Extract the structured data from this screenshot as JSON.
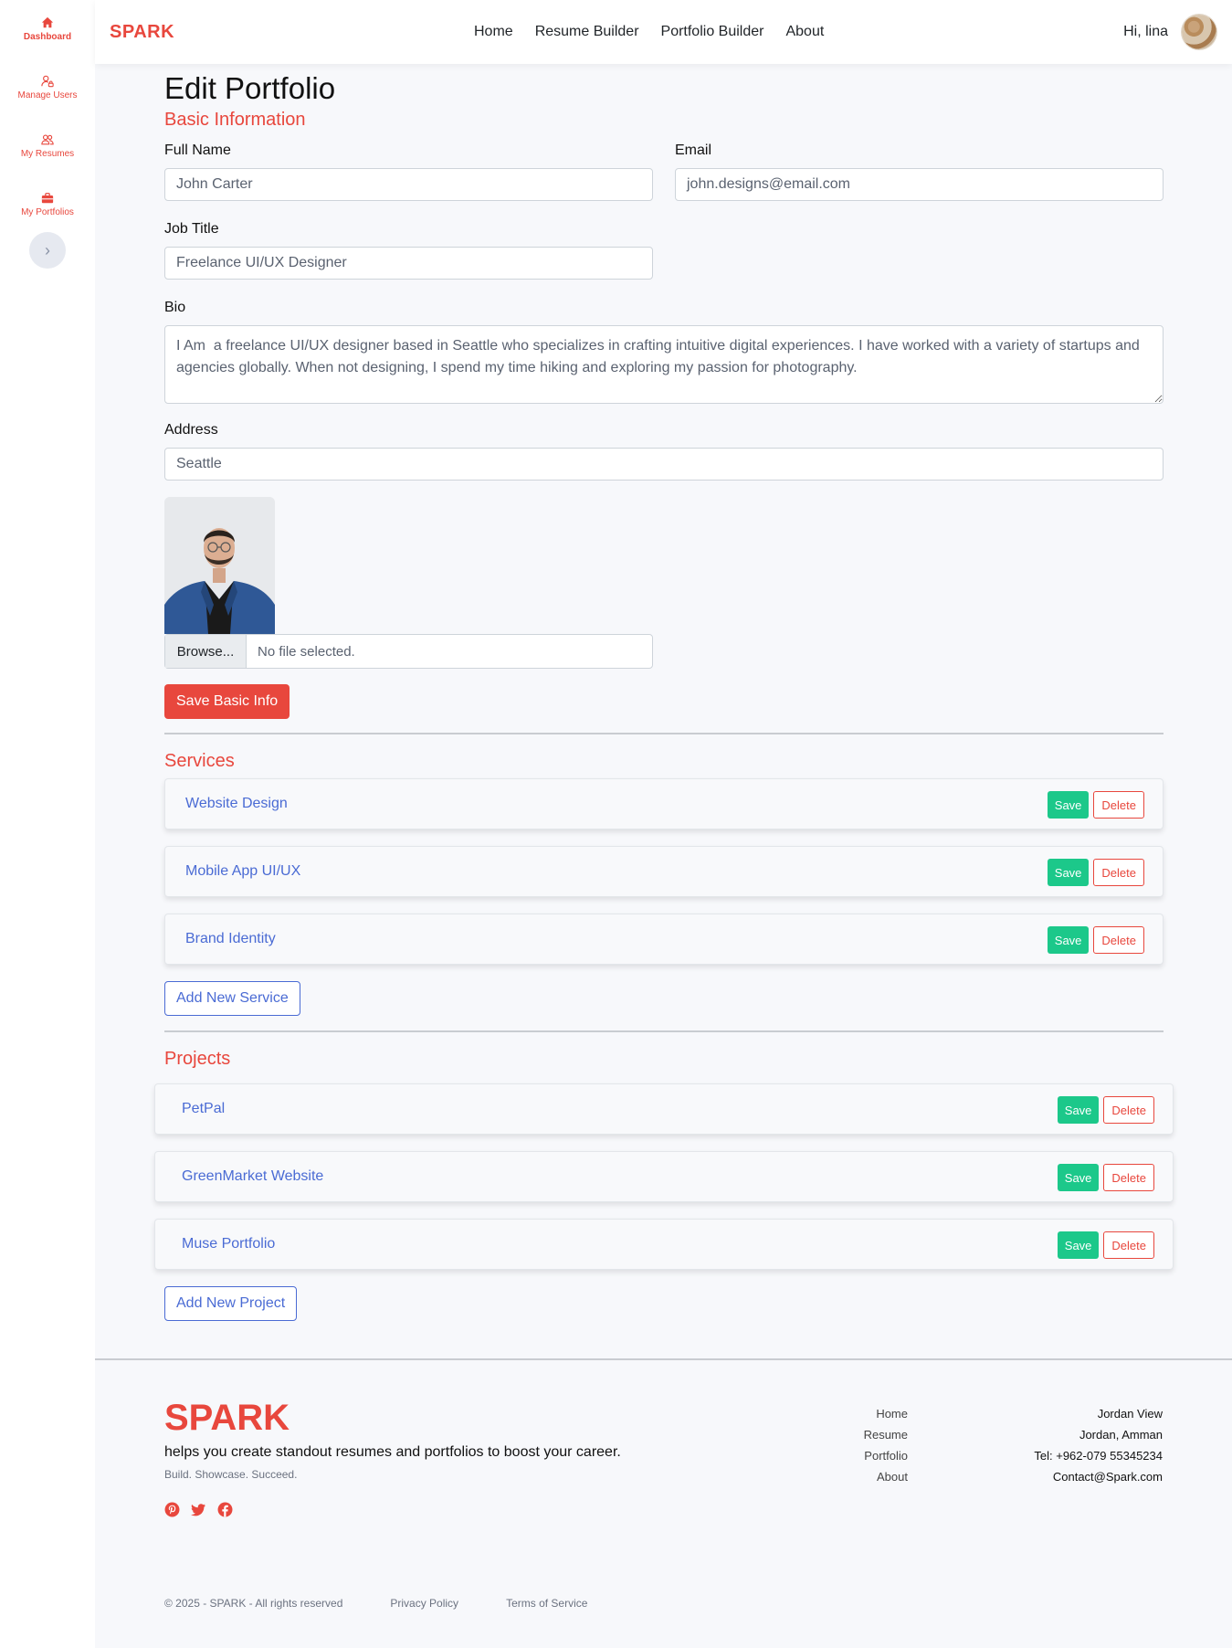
{
  "sidebar": {
    "items": [
      {
        "label": "Dashboard",
        "icon": "home-icon"
      },
      {
        "label": "Manage Users",
        "icon": "user-lock-icon"
      },
      {
        "label": "My Resumes",
        "icon": "users-icon"
      },
      {
        "label": "My Portfolios",
        "icon": "briefcase-icon"
      }
    ],
    "toggle_icon": "chevron-right-icon"
  },
  "header": {
    "brand": "SPARK",
    "nav": [
      "Home",
      "Resume Builder",
      "Portfolio Builder",
      "About"
    ],
    "greeting": "Hi, lina"
  },
  "page": {
    "title": "Edit Portfolio",
    "basic_info": {
      "title": "Basic Information",
      "full_name_label": "Full Name",
      "full_name_value": "John Carter",
      "email_label": "Email",
      "email_value": "john.designs@email.com",
      "job_title_label": "Job Title",
      "job_title_value": "Freelance UI/UX Designer",
      "bio_label": "Bio",
      "bio_value": "I Am  a freelance UI/UX designer based in Seattle who specializes in crafting intuitive digital experiences. I have worked with a variety of startups and agencies globally. When not designing, I spend my time hiking and exploring my passion for photography.",
      "address_label": "Address",
      "address_value": "Seattle",
      "browse_label": "Browse...",
      "file_placeholder": "No file selected.",
      "save_label": "Save Basic Info"
    },
    "services": {
      "title": "Services",
      "items": [
        "Website Design",
        "Mobile App UI/UX",
        "Brand Identity"
      ],
      "save_label": "Save",
      "delete_label": "Delete",
      "add_label": "Add New Service"
    },
    "projects": {
      "title": "Projects",
      "items": [
        "PetPal",
        "GreenMarket Website",
        "Muse Portfolio"
      ],
      "save_label": "Save",
      "delete_label": "Delete",
      "add_label": "Add New Project"
    }
  },
  "footer": {
    "brand": "SPARK",
    "tagline": "helps you create standout resumes and portfolios to boost your career.",
    "sub": "Build. Showcase. Succeed.",
    "social_icons": [
      "pinterest-icon",
      "twitter-icon",
      "facebook-icon"
    ],
    "links": [
      "Home",
      "Resume",
      "Portfolio",
      "About"
    ],
    "contact": [
      "Jordan View",
      "Jordan, Amman",
      "Tel: +962-079 55345234",
      "Contact@Spark.com"
    ],
    "copyright": "© 2025 - SPARK - All rights reserved",
    "privacy": "Privacy Policy",
    "terms": "Terms of Service"
  },
  "colors": {
    "accent": "#e8473d",
    "link": "#4a6bd4",
    "success": "#1cc88a"
  }
}
